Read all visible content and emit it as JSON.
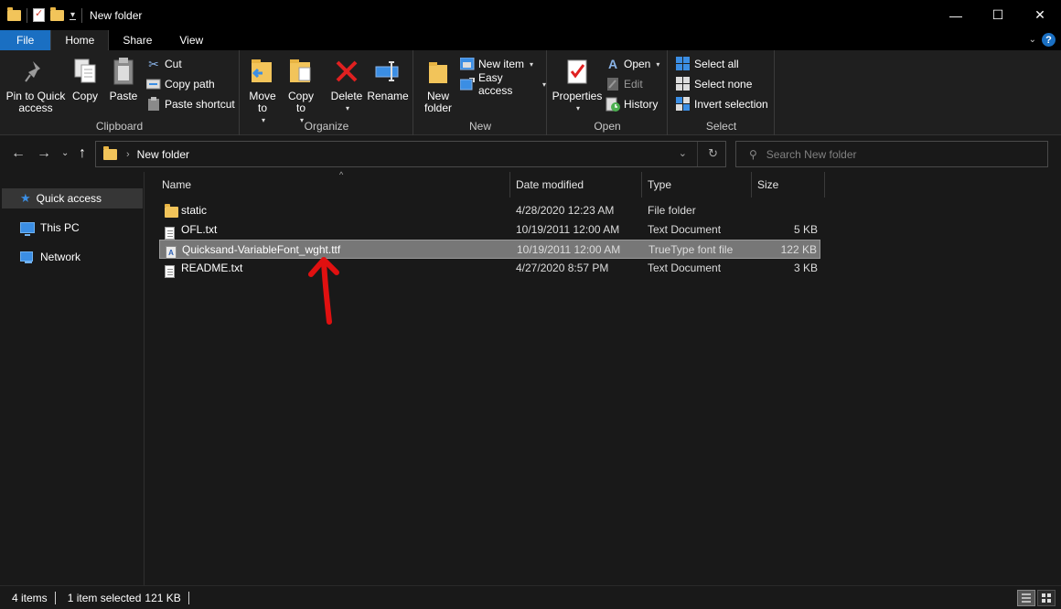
{
  "window": {
    "title": "New folder",
    "controls": {
      "minimize": "—",
      "maximize": "☐",
      "close": "✕"
    }
  },
  "ribbon_tabs": [
    {
      "label": "File"
    },
    {
      "label": "Home"
    },
    {
      "label": "Share"
    },
    {
      "label": "View"
    }
  ],
  "ribbon": {
    "clipboard": {
      "label": "Clipboard",
      "pin": "Pin to Quick access",
      "copy": "Copy",
      "paste": "Paste",
      "cut": "Cut",
      "copy_path": "Copy path",
      "paste_shortcut": "Paste shortcut"
    },
    "organize": {
      "label": "Organize",
      "move_to": "Move to",
      "copy_to": "Copy to",
      "delete": "Delete",
      "rename": "Rename"
    },
    "new": {
      "label": "New",
      "new_folder": "New folder",
      "new_item": "New item",
      "easy_access": "Easy access"
    },
    "open": {
      "label": "Open",
      "properties": "Properties",
      "open": "Open",
      "edit": "Edit",
      "history": "History"
    },
    "select": {
      "label": "Select",
      "select_all": "Select all",
      "select_none": "Select none",
      "invert_selection": "Invert selection"
    }
  },
  "address": {
    "path": "New folder",
    "search_placeholder": "Search New folder"
  },
  "nav_pane": [
    {
      "label": "Quick access",
      "selected": true
    },
    {
      "label": "This PC"
    },
    {
      "label": "Network"
    }
  ],
  "columns": {
    "name": "Name",
    "date": "Date modified",
    "type": "Type",
    "size": "Size"
  },
  "files": [
    {
      "name": "static",
      "date": "4/28/2020 12:23 AM",
      "type": "File folder",
      "size": "",
      "icon": "folder-icon"
    },
    {
      "name": "OFL.txt",
      "date": "10/19/2011 12:00 AM",
      "type": "Text Document",
      "size": "5 KB",
      "icon": "text-file-icon"
    },
    {
      "name": "Quicksand-VariableFont_wght.ttf",
      "date": "10/19/2011 12:00 AM",
      "type": "TrueType font file",
      "size": "122 KB",
      "icon": "font-file-icon",
      "selected": true
    },
    {
      "name": "README.txt",
      "date": "4/27/2020 8:57 PM",
      "type": "Text Document",
      "size": "3 KB",
      "icon": "text-file-icon"
    }
  ],
  "status": {
    "items": "4 items",
    "selected": "1 item selected",
    "selected_size": "121 KB"
  },
  "colors": {
    "accent": "#1a6fc2",
    "annotation": "#e01010",
    "selection": "#777777"
  }
}
